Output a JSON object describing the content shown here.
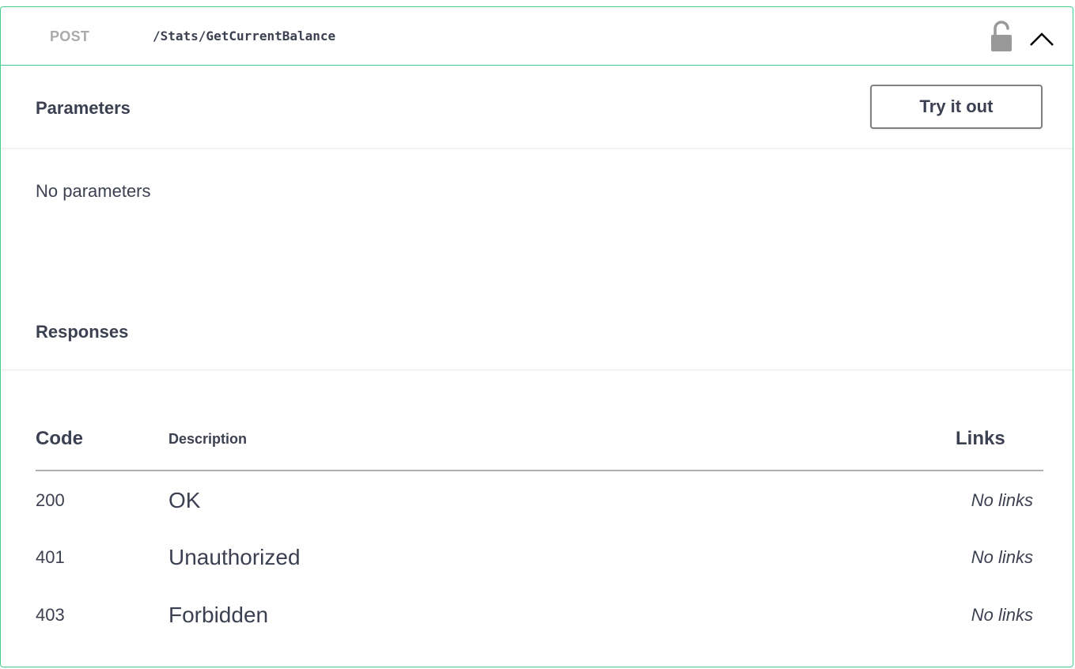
{
  "endpoint": {
    "method": "POST",
    "path": "/Stats/GetCurrentBalance",
    "lock_icon": "unlocked-padlock-icon",
    "collapse_icon": "chevron-up-icon",
    "accent_color": "#49cc90"
  },
  "parameters": {
    "title": "Parameters",
    "try_button_label": "Try it out",
    "empty_text": "No parameters"
  },
  "responses": {
    "title": "Responses",
    "headers": {
      "code": "Code",
      "description": "Description",
      "links": "Links"
    },
    "rows": [
      {
        "code": "200",
        "description": "OK",
        "links": "No links"
      },
      {
        "code": "401",
        "description": "Unauthorized",
        "links": "No links"
      },
      {
        "code": "403",
        "description": "Forbidden",
        "links": "No links"
      }
    ]
  }
}
